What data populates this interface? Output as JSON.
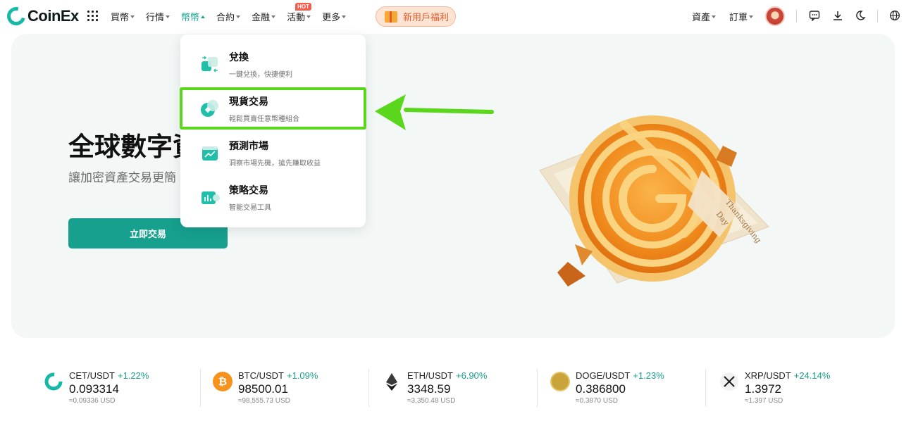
{
  "header": {
    "logo": "CoinEx",
    "nav": [
      {
        "label": "買幣"
      },
      {
        "label": "行情"
      },
      {
        "label": "幣幣"
      },
      {
        "label": "合約"
      },
      {
        "label": "金融"
      },
      {
        "label": "活動",
        "badge": "HOT"
      },
      {
        "label": "更多"
      }
    ],
    "promo_label": "新用戶福利",
    "right_nav": [
      {
        "label": "資產"
      },
      {
        "label": "訂單"
      }
    ]
  },
  "hero": {
    "title": "全球數字資",
    "subtitle": "讓加密資產交易更簡",
    "cta": "立即交易",
    "art_text": [
      "Thanksgiving",
      "Day"
    ]
  },
  "dropdown": {
    "items": [
      {
        "title": "兌換",
        "desc": "一鍵兌換，快捷便利",
        "icon": "exchange-icon"
      },
      {
        "title": "現貨交易",
        "desc": "輕鬆買賣任意幣種組合",
        "icon": "spot-trade-icon"
      },
      {
        "title": "預測市場",
        "desc": "洞察市場先機，搶先賺取收益",
        "icon": "prediction-icon"
      },
      {
        "title": "策略交易",
        "desc": "智能交易工具",
        "icon": "strategy-icon"
      }
    ]
  },
  "tickers": [
    {
      "pair": "CET/USDT",
      "change": "+1.22%",
      "price": "0.093314",
      "usd": "≈0.09336 USD"
    },
    {
      "pair": "BTC/USDT",
      "change": "+1.09%",
      "price": "98500.01",
      "usd": "≈98,555.73 USD"
    },
    {
      "pair": "ETH/USDT",
      "change": "+6.90%",
      "price": "3348.59",
      "usd": "≈3,350.48 USD"
    },
    {
      "pair": "DOGE/USDT",
      "change": "+1.23%",
      "price": "0.386800",
      "usd": "≈0.3870 USD"
    },
    {
      "pair": "XRP/USDT",
      "change": "+24.14%",
      "price": "1.3972",
      "usd": "≈1.397 USD"
    }
  ],
  "colors": {
    "brand": "#17a08e",
    "positive": "#17a08e",
    "highlight": "#5ad71c",
    "hot_badge": "#f35b4a"
  }
}
